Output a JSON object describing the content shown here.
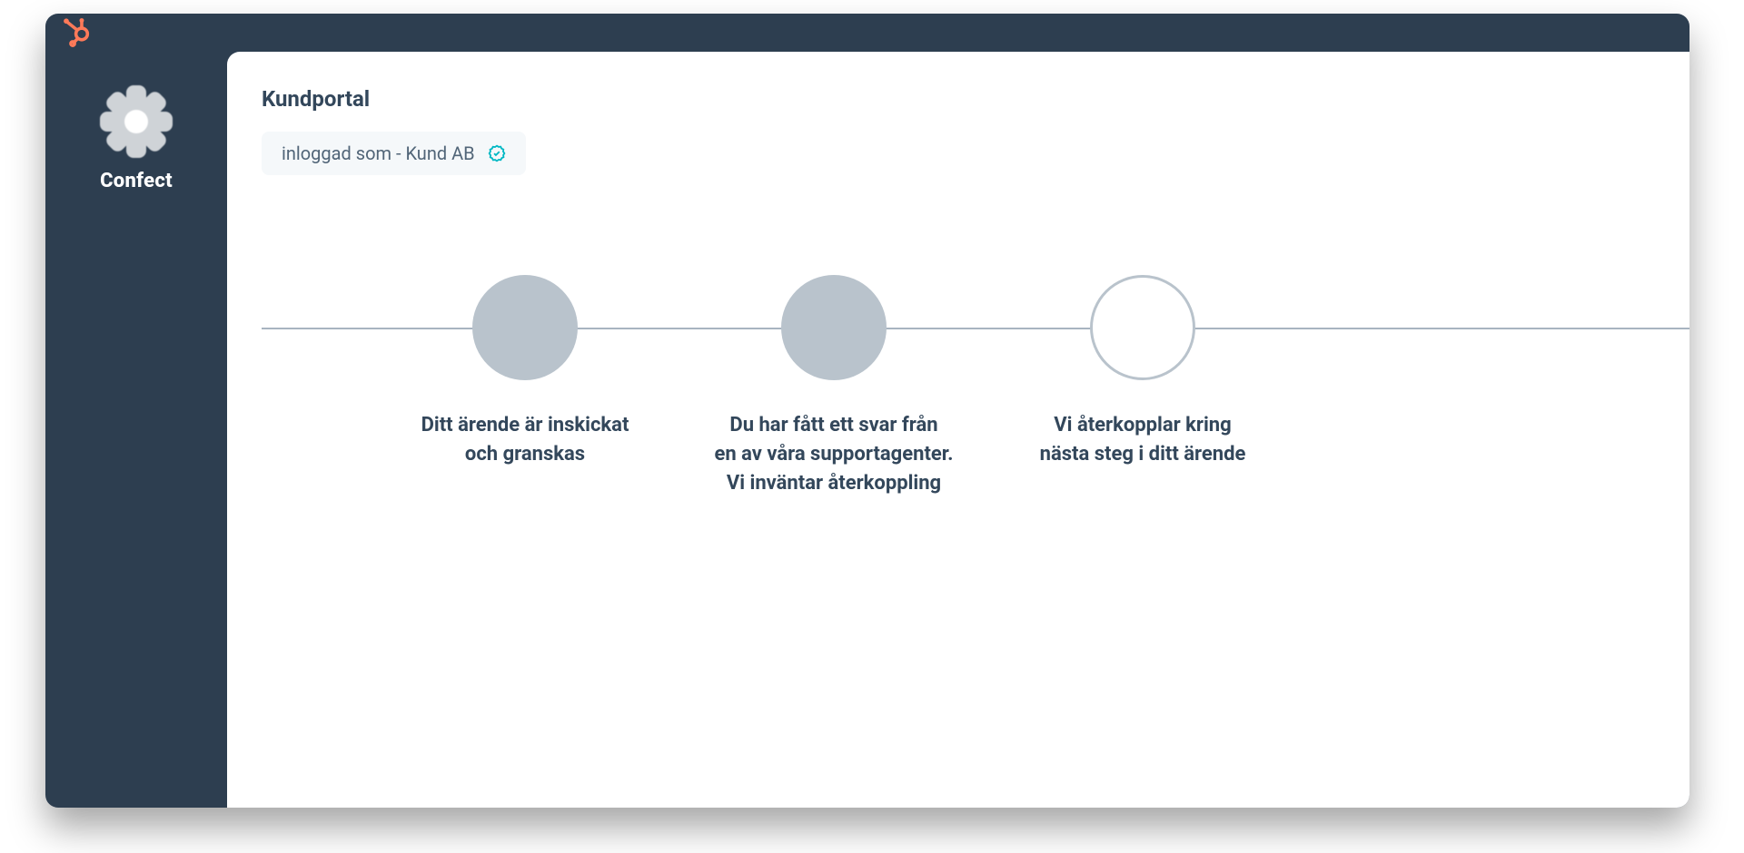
{
  "brand": {
    "name": "Confect"
  },
  "header": {
    "title": "Kundportal",
    "logged_in_as": "inloggad som - Kund AB"
  },
  "progress": {
    "steps": [
      {
        "label": "Ditt ärende är inskickat\noch granskas",
        "state": "done"
      },
      {
        "label": "Du har fått ett svar från\nen av våra supportagenter.\nVi inväntar återkoppling",
        "state": "done"
      },
      {
        "label": "Vi återkopplar kring\nnästa steg i ditt ärende",
        "state": "pending"
      }
    ]
  },
  "colors": {
    "frame_bg": "#2d3e50",
    "accent": "#ff7a59",
    "muted_circle": "#b9c3cc",
    "text": "#33475b"
  }
}
